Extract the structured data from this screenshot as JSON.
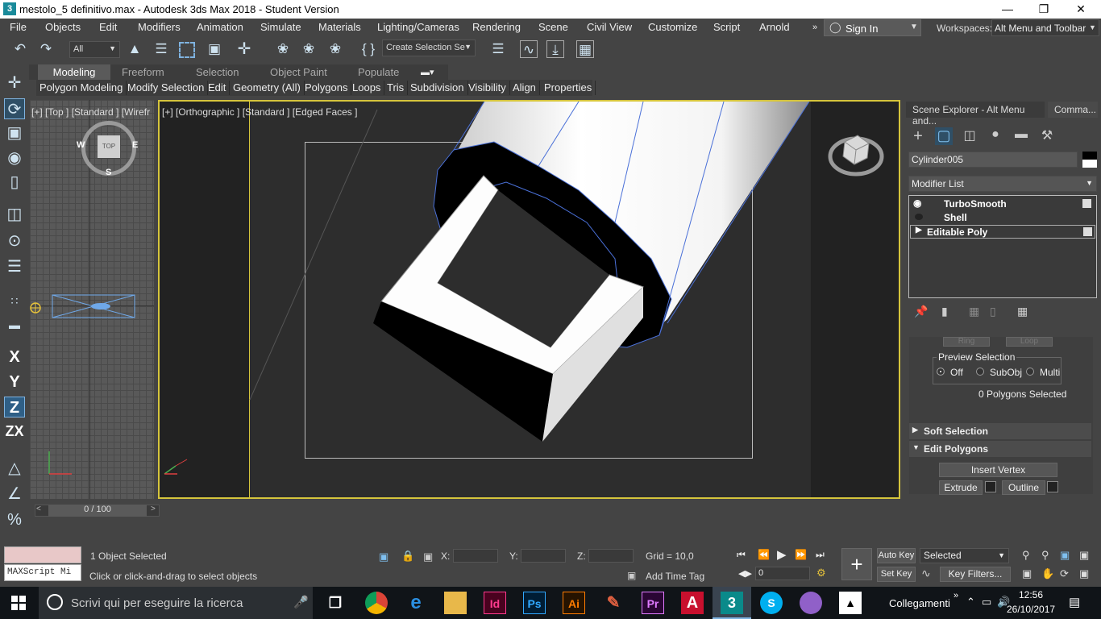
{
  "window": {
    "title": "mestolo_5 definitivo.max - Autodesk 3ds Max 2018 - Student Version",
    "app_icon": "3"
  },
  "menu": [
    "File",
    "Objects",
    "Edit",
    "Modifiers",
    "Animation",
    "Simulate",
    "Materials",
    "Lighting/Cameras",
    "Rendering",
    "Scene",
    "Civil View",
    "Customize",
    "Script",
    "Arnold"
  ],
  "signin": {
    "label": "Sign In"
  },
  "workspaces": {
    "label": "Workspaces:",
    "value": "Alt Menu and Toolbar"
  },
  "toolbar": {
    "filter": "All",
    "named_selection": "Create Selection Se"
  },
  "ribbon": {
    "tabs": [
      "Modeling",
      "Freeform",
      "Selection",
      "Object Paint",
      "Populate"
    ],
    "items": [
      "Polygon Modeling",
      "Modify Selection",
      "Edit",
      "Geometry (All)",
      "Polygons",
      "Loops",
      "Tris",
      "Subdivision",
      "Visibility",
      "Align",
      "Properties"
    ]
  },
  "left_toolbar": {
    "x": "X",
    "y": "Y",
    "z": "Z",
    "zx": "ZX"
  },
  "viewports": {
    "top_label": "[+] [Top ] [Standard ] [Wirefr",
    "main_label": "[+] [Orthographic ] [Standard ] [Edged Faces ]",
    "compass": {
      "top": "TOP",
      "w": "W",
      "e": "E",
      "s": "S"
    }
  },
  "command_panel": {
    "tabs": [
      "Scene Explorer - Alt Menu and...",
      "Comma..."
    ],
    "object_name": "Cylinder005",
    "modifier_list": "Modifier List",
    "stack": [
      "TurboSmooth",
      "Shell",
      "Editable Poly"
    ],
    "ring_loop": [
      "Ring",
      "Loop"
    ],
    "preview_selection": {
      "title": "Preview Selection",
      "options": [
        "Off",
        "SubObj",
        "Multi"
      ],
      "selected": "Off"
    },
    "selection_status": "0 Polygons Selected",
    "rollouts": [
      "Soft Selection",
      "Edit Polygons"
    ],
    "buttons": {
      "insert_vertex": "Insert Vertex",
      "extrude": "Extrude",
      "outline": "Outline"
    }
  },
  "timeline": {
    "frame": "0 / 100"
  },
  "status": {
    "objects_selected": "1 Object Selected",
    "prompt": "Click or click-and-drag to select objects",
    "maxscript": "MAXScript Mi",
    "x_label": "X:",
    "y_label": "Y:",
    "z_label": "Z:",
    "grid": "Grid = 10,0",
    "add_time_tag": "Add Time Tag",
    "auto_key": "Auto Key",
    "set_key": "Set Key",
    "key_mode": "Selected",
    "key_filters": "Key Filters...",
    "frame_value": "0"
  },
  "taskbar": {
    "search": "Scrivi qui per eseguire la ricerca",
    "links": "Collegamenti",
    "time": "12:56",
    "date": "26/10/2017",
    "app_icons": [
      "task-view",
      "chrome",
      "edge",
      "explorer",
      "indesign",
      "photoshop",
      "illustrator",
      "app",
      "premiere",
      "autocad",
      "3dsmax",
      "skype",
      "app2",
      "photos"
    ],
    "app_labels": {
      "indesign": "Id",
      "photoshop": "Ps",
      "illustrator": "Ai",
      "premiere": "Pr",
      "autocad": "A",
      "3dsmax": "3"
    }
  }
}
